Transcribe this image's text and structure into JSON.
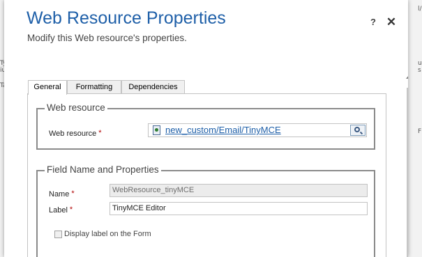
{
  "background": {
    "left_fragments": [
      "Ty",
      "iu",
      "Ta"
    ],
    "right_fragments": [
      "l/",
      "u",
      "s",
      "F"
    ]
  },
  "dialog": {
    "title": "Web Resource Properties",
    "subtitle": "Modify this Web resource's properties.",
    "help_label": "?",
    "close_label": "✕"
  },
  "tabs": [
    {
      "label": "General",
      "active": true
    },
    {
      "label": "Formatting",
      "active": false
    },
    {
      "label": "Dependencies",
      "active": false
    }
  ],
  "web_resource_section": {
    "legend": "Web resource",
    "field_label": "Web resource",
    "required_mark": "*",
    "value": "new_custom/Email/TinyMCE"
  },
  "field_section": {
    "legend": "Field Name and Properties",
    "name_label": "Name",
    "name_value": "WebResource_tinyMCE",
    "label_label": "Label",
    "label_value": "TinyMCE Editor",
    "required_mark": "*",
    "checkbox_label": "Display label on the Form",
    "checkbox_checked": false
  },
  "colors": {
    "title": "#1e5fa8",
    "link": "#1e5fa8",
    "required": "#b00000"
  }
}
